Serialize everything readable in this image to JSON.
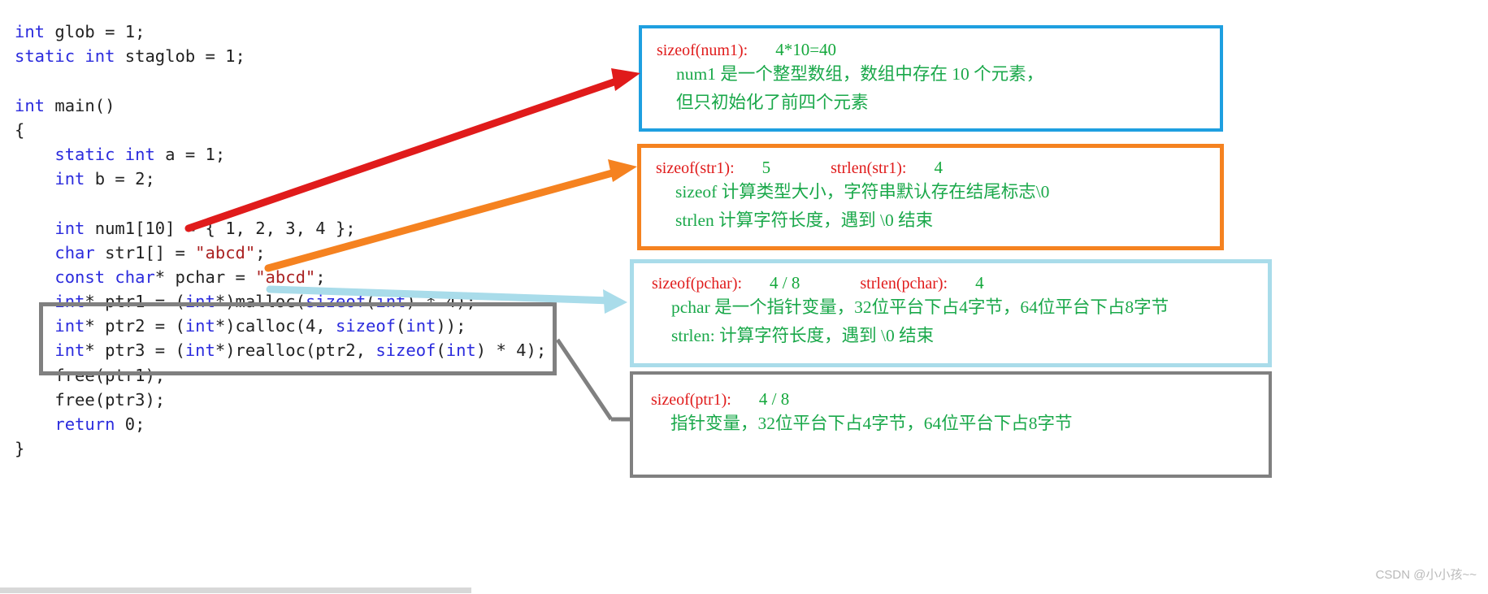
{
  "code": {
    "language": "c",
    "lines": [
      [
        {
          "t": "int",
          "c": "kw"
        },
        {
          "t": " glob = 1;",
          "c": "pl"
        }
      ],
      [
        {
          "t": "static int",
          "c": "kw"
        },
        {
          "t": " staglob = 1;",
          "c": "pl"
        }
      ],
      [],
      [
        {
          "t": "int",
          "c": "kw"
        },
        {
          "t": " main()",
          "c": "pl"
        }
      ],
      [
        {
          "t": "{",
          "c": "pl"
        }
      ],
      [
        {
          "t": "    ",
          "c": "pl"
        },
        {
          "t": "static int",
          "c": "kw"
        },
        {
          "t": " a = 1;",
          "c": "pl"
        }
      ],
      [
        {
          "t": "    ",
          "c": "pl"
        },
        {
          "t": "int",
          "c": "kw"
        },
        {
          "t": " b = 2;",
          "c": "pl"
        }
      ],
      [],
      [
        {
          "t": "    ",
          "c": "pl"
        },
        {
          "t": "int",
          "c": "kw"
        },
        {
          "t": " num1[10] = { 1, 2, 3, 4 };",
          "c": "pl"
        }
      ],
      [
        {
          "t": "    ",
          "c": "pl"
        },
        {
          "t": "char",
          "c": "kw"
        },
        {
          "t": " str1[] = ",
          "c": "pl"
        },
        {
          "t": "\"abcd\"",
          "c": "str"
        },
        {
          "t": ";",
          "c": "pl"
        }
      ],
      [
        {
          "t": "    ",
          "c": "pl"
        },
        {
          "t": "const char",
          "c": "kw"
        },
        {
          "t": "* pchar = ",
          "c": "pl"
        },
        {
          "t": "\"abcd\"",
          "c": "str"
        },
        {
          "t": ";",
          "c": "pl"
        }
      ],
      [
        {
          "t": "    ",
          "c": "pl"
        },
        {
          "t": "int",
          "c": "kw"
        },
        {
          "t": "* ptr1 = (",
          "c": "pl"
        },
        {
          "t": "int",
          "c": "kw"
        },
        {
          "t": "*)malloc(",
          "c": "pl"
        },
        {
          "t": "sizeof",
          "c": "kw"
        },
        {
          "t": "(",
          "c": "pl"
        },
        {
          "t": "int",
          "c": "kw"
        },
        {
          "t": ") * 4);",
          "c": "pl"
        }
      ],
      [
        {
          "t": "    ",
          "c": "pl"
        },
        {
          "t": "int",
          "c": "kw"
        },
        {
          "t": "* ptr2 = (",
          "c": "pl"
        },
        {
          "t": "int",
          "c": "kw"
        },
        {
          "t": "*)calloc(4, ",
          "c": "pl"
        },
        {
          "t": "sizeof",
          "c": "kw"
        },
        {
          "t": "(",
          "c": "pl"
        },
        {
          "t": "int",
          "c": "kw"
        },
        {
          "t": "));",
          "c": "pl"
        }
      ],
      [
        {
          "t": "    ",
          "c": "pl"
        },
        {
          "t": "int",
          "c": "kw"
        },
        {
          "t": "* ptr3 = (",
          "c": "pl"
        },
        {
          "t": "int",
          "c": "kw"
        },
        {
          "t": "*)realloc(ptr2, ",
          "c": "pl"
        },
        {
          "t": "sizeof",
          "c": "kw"
        },
        {
          "t": "(",
          "c": "pl"
        },
        {
          "t": "int",
          "c": "kw"
        },
        {
          "t": ") * 4);",
          "c": "pl"
        }
      ],
      [
        {
          "t": "    free(ptr1);",
          "c": "pl"
        }
      ],
      [
        {
          "t": "    free(ptr3);",
          "c": "pl"
        }
      ],
      [
        {
          "t": "    ",
          "c": "pl"
        },
        {
          "t": "return",
          "c": "kw"
        },
        {
          "t": " 0;",
          "c": "pl"
        }
      ],
      [
        {
          "t": "}",
          "c": "pl"
        }
      ]
    ]
  },
  "notes": [
    {
      "id": "num1",
      "border_color": "#1e9fe0",
      "label": "sizeof(num1):",
      "value": "4*10=40",
      "value2_label": "",
      "value2": "",
      "body_line1": "num1 是一个整型数组，数组中存在 10 个元素，",
      "body_line2": "但只初始化了前四个元素"
    },
    {
      "id": "str1",
      "border_color": "#f58220",
      "label": "sizeof(str1):",
      "value": "5",
      "value2_label": "strlen(str1):",
      "value2": "4",
      "body_line1": "sizeof 计算类型大小，字符串默认存在结尾标志\\0",
      "body_line2": "strlen 计算字符长度，遇到 \\0 结束"
    },
    {
      "id": "pchar",
      "border_color": "#a9dcea",
      "label": "sizeof(pchar):",
      "value": "4 / 8",
      "value2_label": "strlen(pchar):",
      "value2": "4",
      "body_line1": "pchar 是一个指针变量，32位平台下占4字节，64位平台下占8字节",
      "body_line2": "strlen: 计算字符长度，遇到 \\0 结束"
    },
    {
      "id": "ptr1",
      "border_color": "#808080",
      "label": "sizeof(ptr1):",
      "value": "4 / 8",
      "value2_label": "",
      "value2": "",
      "body_line1": "指针变量，32位平台下占4字节，64位平台下占8字节",
      "body_line2": ""
    }
  ],
  "arrows": [
    {
      "name": "arrow-num1",
      "color": "#e01b1b",
      "from_label": "num1[10] declaration",
      "to_label": "sizeof(num1) note"
    },
    {
      "name": "arrow-str1",
      "color": "#f58220",
      "from_label": "str1[] declaration",
      "to_label": "sizeof(str1) note"
    },
    {
      "name": "arrow-pchar",
      "color": "#a9dcea",
      "from_label": "pchar declaration",
      "to_label": "sizeof(pchar) note"
    },
    {
      "name": "arrow-ptr1",
      "color": "#808080",
      "from_label": "alloc code block",
      "to_label": "sizeof(ptr1) note"
    }
  ],
  "highlight_box": {
    "name": "alloc-code-outline",
    "color": "#808080"
  },
  "watermark": "CSDN @小小孩~~",
  "colors": {
    "keyword": "#2b2bdd",
    "string": "#aa2222",
    "plain": "#222222",
    "note_label": "#e01b1b",
    "note_value": "#14a83c",
    "note_body": "#1aa84a",
    "box_blue": "#1e9fe0",
    "box_orange": "#f58220",
    "box_lightblue": "#a9dcea",
    "box_gray": "#808080"
  }
}
